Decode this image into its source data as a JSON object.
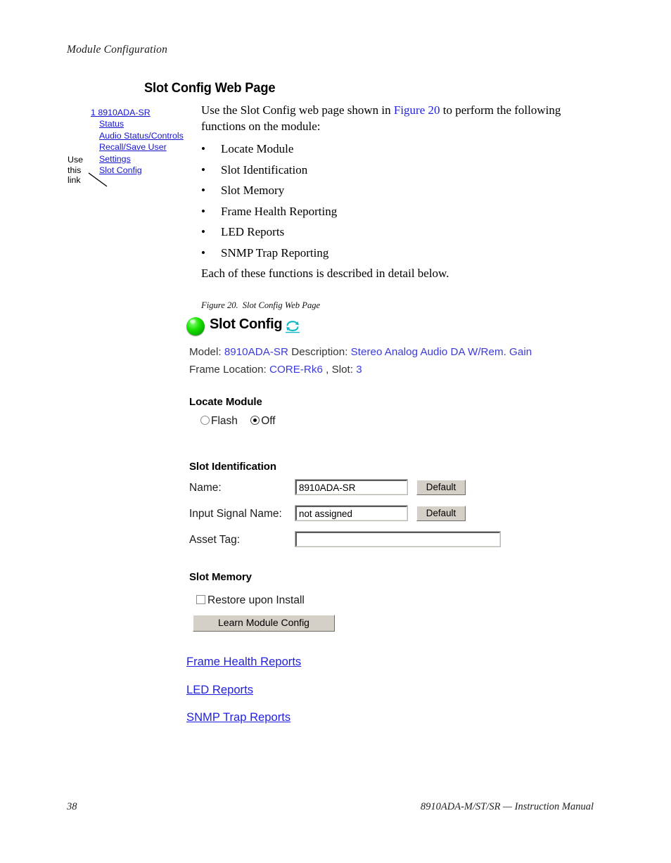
{
  "running_head": "Module Configuration",
  "section_heading": "Slot Config Web Page",
  "nav_callout": {
    "annotation_line1": "Use",
    "annotation_line2": "this",
    "annotation_line3": "link",
    "links": [
      {
        "label": "1 8910ADA-SR"
      },
      {
        "label": "Status"
      },
      {
        "label": "Audio Status/Controls"
      },
      {
        "label": "Recall/Save User"
      },
      {
        "label": "Settings"
      },
      {
        "label": "Slot Config"
      }
    ]
  },
  "body": {
    "intro_before": "Use the Slot Config web page shown in ",
    "intro_xref": "Figure 20",
    "intro_after": " to perform the following functions on the module:",
    "bullets": [
      "Locate Module",
      "Slot Identification",
      "Slot Memory",
      "Frame Health Reporting",
      "LED Reports",
      "SNMP Trap Reporting"
    ],
    "closing": "Each of these functions is described in detail below."
  },
  "figure": {
    "number": "Figure 20.",
    "caption": "Slot Config Web Page"
  },
  "webpage": {
    "led_icon": "green-status-led",
    "title": "Slot Config",
    "refresh_icon": "refresh-icon",
    "meta": {
      "model_label": "Model:",
      "model_value": "8910ADA-SR",
      "description_label": "Description:",
      "description_value": "Stereo Analog Audio DA W/Rem. Gain",
      "frame_location_label": "Frame Location:",
      "frame_location_value": "CORE-Rk6",
      "slot_label": ", Slot:",
      "slot_value": "3"
    },
    "locate_module": {
      "heading": "Locate Module",
      "options": [
        {
          "label": "Flash",
          "selected": false
        },
        {
          "label": "Off",
          "selected": true
        }
      ]
    },
    "slot_identification": {
      "heading": "Slot Identification",
      "fields": [
        {
          "label": "Name:",
          "value": "8910ADA-SR",
          "button": "Default"
        },
        {
          "label": "Input Signal Name:",
          "value": "not assigned",
          "button": "Default"
        },
        {
          "label": "Asset Tag:",
          "value": "",
          "button": ""
        }
      ]
    },
    "slot_memory": {
      "heading": "Slot Memory",
      "checkbox_label": "Restore upon Install",
      "checkbox_checked": false,
      "button": "Learn Module Config"
    },
    "report_links": [
      {
        "label": "Frame Health Reports"
      },
      {
        "label": "LED Reports"
      },
      {
        "label": "SNMP Trap Reports"
      }
    ]
  },
  "footer": {
    "page_number": "38",
    "manual_title": "8910ADA-M/ST/SR — Instruction Manual"
  },
  "colors": {
    "link": "#1414cf",
    "value_blue": "#3b3bdd",
    "xref_blue": "#2222dd",
    "led_green": "#17e000",
    "button_face": "#d4d0c8"
  }
}
